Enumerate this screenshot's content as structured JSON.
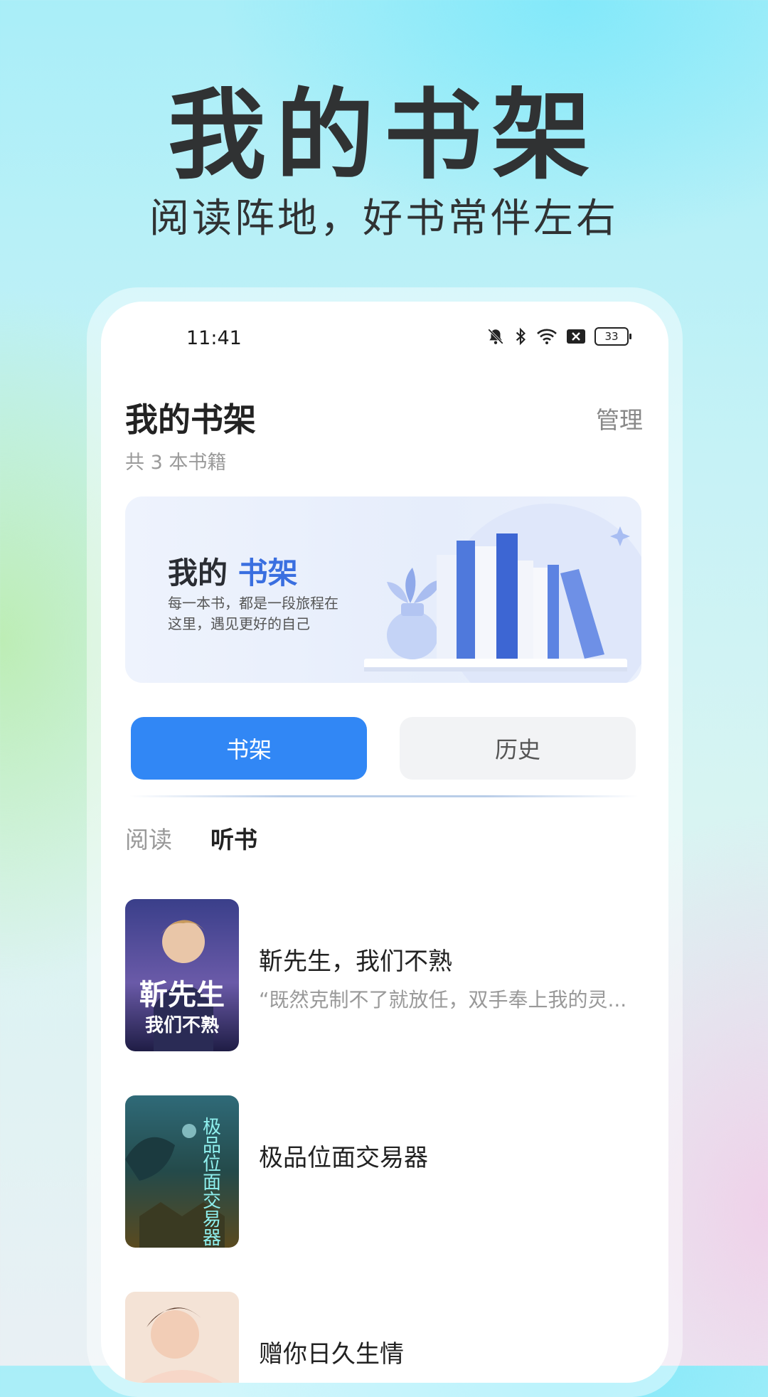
{
  "promo": {
    "title": "我的书架",
    "subtitle": "阅读阵地，好书常伴左右"
  },
  "status_bar": {
    "time": "11:41",
    "battery": "33",
    "icons": [
      "mute-bell-icon",
      "bluetooth-icon",
      "wifi-icon",
      "sim-off-icon",
      "battery-icon"
    ]
  },
  "header": {
    "title": "我的书架",
    "manage": "管理",
    "count": "共 3 本书籍"
  },
  "banner": {
    "title_part1": "我的",
    "title_part2": "书架",
    "desc_line1": "每一本书，都是一段旅程在",
    "desc_line2": "这里，遇见更好的自己",
    "accent_color": "#3a6fe0"
  },
  "tabs": {
    "shelf": "书架",
    "history": "历史",
    "active": "书架",
    "active_color": "#3187f5"
  },
  "subtabs": {
    "read": "阅读",
    "listen": "听书",
    "active": "听书"
  },
  "books": [
    {
      "title": "靳先生，我们不熟",
      "desc": "“既然克制不了就放任，双手奉上我的灵...",
      "cover_text_1": "靳先生",
      "cover_text_2": "我们不熟"
    },
    {
      "title": "极品位面交易器",
      "desc": "",
      "cover_text_1": "极品位面交易器"
    },
    {
      "title": "赠你日久生情",
      "desc": ""
    }
  ]
}
